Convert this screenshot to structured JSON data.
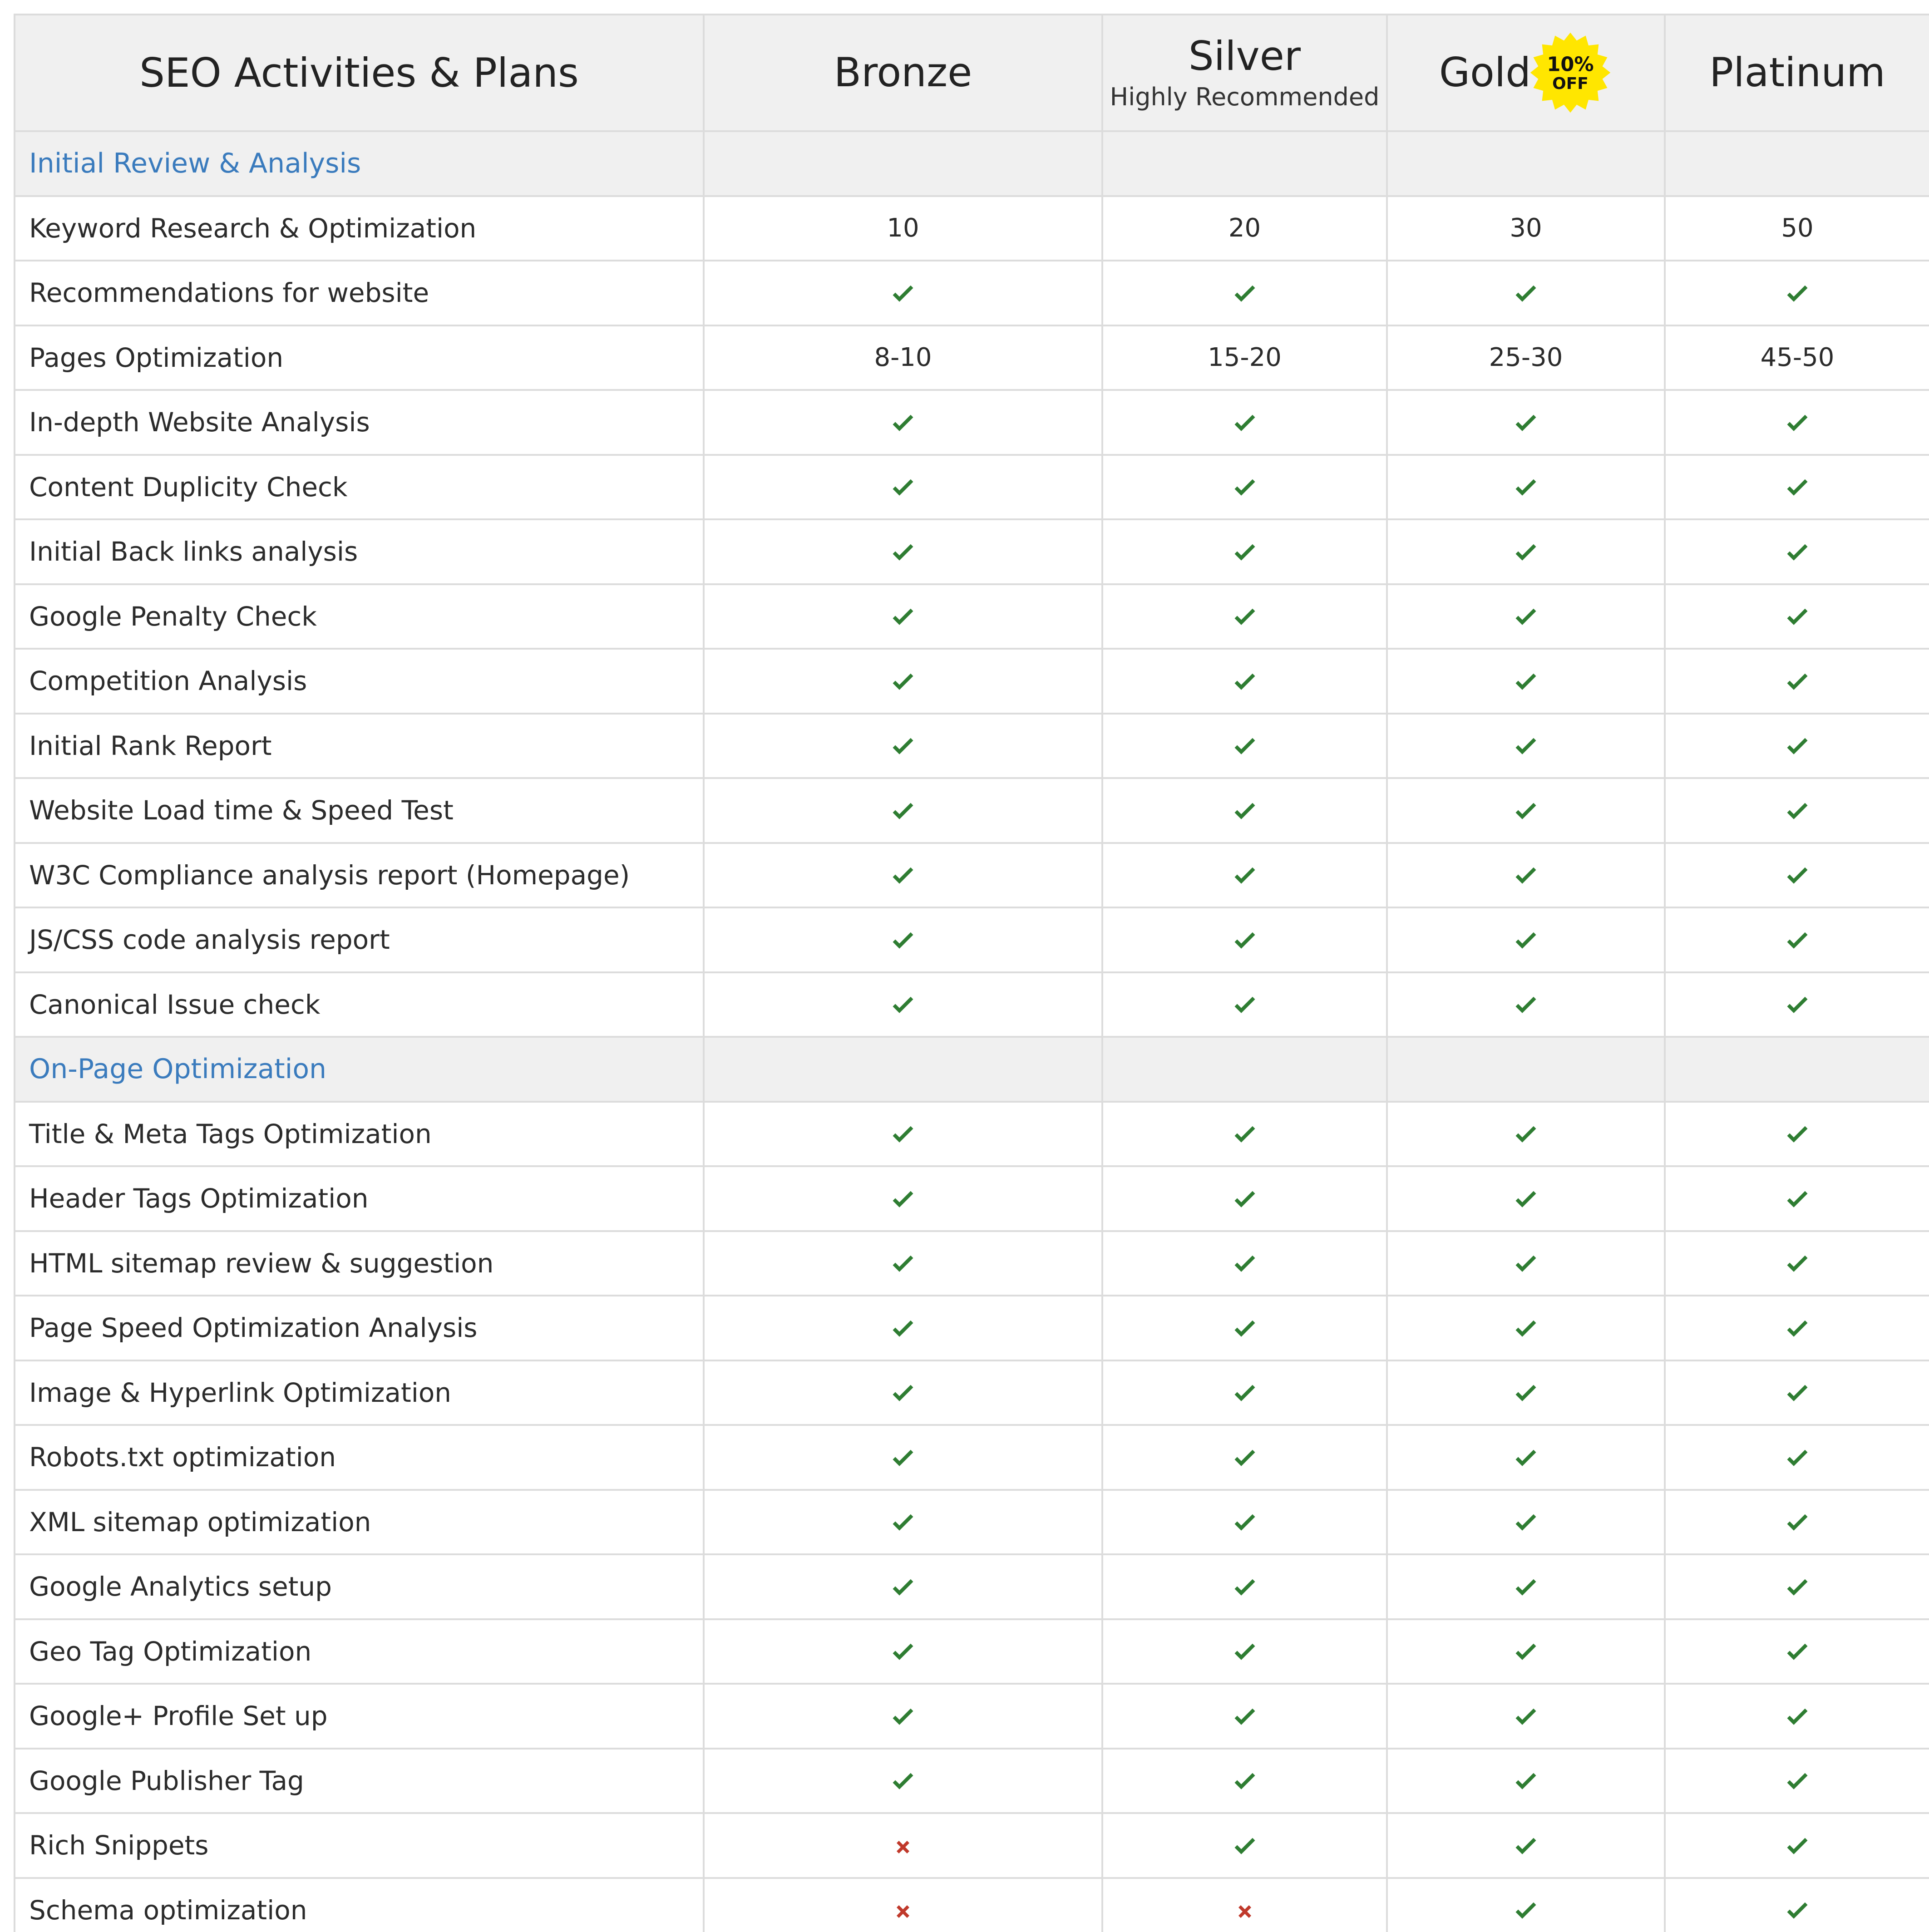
{
  "header": {
    "feature_title": "SEO Activities & Plans",
    "plans": [
      {
        "name": "Bronze",
        "subtitle": ""
      },
      {
        "name": "Silver",
        "subtitle": "Highly Recommended"
      },
      {
        "name": "Gold",
        "subtitle": "",
        "badge_line1": "10%",
        "badge_line2": "OFF"
      },
      {
        "name": "Platinum",
        "subtitle": ""
      }
    ]
  },
  "colors": {
    "section_label": "#3a7bbd",
    "check": "#2e7d32",
    "cross": "#c0392b",
    "header_bg": "#f0f0f0",
    "border": "#dcdcdc",
    "badge": "#ffe600"
  },
  "rows": [
    {
      "type": "section",
      "label": "Initial Review & Analysis"
    },
    {
      "type": "feature",
      "label": "Keyword Research & Optimization",
      "values": [
        "10",
        "20",
        "30",
        "50"
      ]
    },
    {
      "type": "feature",
      "label": "Recommendations for website",
      "values": [
        "check",
        "check",
        "check",
        "check"
      ]
    },
    {
      "type": "feature",
      "label": "Pages Optimization",
      "values": [
        "8-10",
        "15-20",
        "25-30",
        "45-50"
      ]
    },
    {
      "type": "feature",
      "label": "In-depth Website Analysis",
      "values": [
        "check",
        "check",
        "check",
        "check"
      ]
    },
    {
      "type": "feature",
      "label": "Content Duplicity Check",
      "values": [
        "check",
        "check",
        "check",
        "check"
      ]
    },
    {
      "type": "feature",
      "label": "Initial Back links analysis",
      "values": [
        "check",
        "check",
        "check",
        "check"
      ]
    },
    {
      "type": "feature",
      "label": "Google Penalty Check",
      "values": [
        "check",
        "check",
        "check",
        "check"
      ]
    },
    {
      "type": "feature",
      "label": "Competition Analysis",
      "values": [
        "check",
        "check",
        "check",
        "check"
      ]
    },
    {
      "type": "feature",
      "label": "Initial Rank Report",
      "values": [
        "check",
        "check",
        "check",
        "check"
      ]
    },
    {
      "type": "feature",
      "label": "Website Load time & Speed Test",
      "values": [
        "check",
        "check",
        "check",
        "check"
      ]
    },
    {
      "type": "feature",
      "label": "W3C Compliance analysis report (Homepage)",
      "values": [
        "check",
        "check",
        "check",
        "check"
      ]
    },
    {
      "type": "feature",
      "label": "JS/CSS code analysis report",
      "values": [
        "check",
        "check",
        "check",
        "check"
      ]
    },
    {
      "type": "feature",
      "label": "Canonical Issue check",
      "values": [
        "check",
        "check",
        "check",
        "check"
      ]
    },
    {
      "type": "section",
      "label": "On-Page Optimization"
    },
    {
      "type": "feature",
      "label": "Title & Meta Tags Optimization",
      "values": [
        "check",
        "check",
        "check",
        "check"
      ]
    },
    {
      "type": "feature",
      "label": "Header Tags Optimization",
      "values": [
        "check",
        "check",
        "check",
        "check"
      ]
    },
    {
      "type": "feature",
      "label": "HTML sitemap review & suggestion",
      "values": [
        "check",
        "check",
        "check",
        "check"
      ]
    },
    {
      "type": "feature",
      "label": "Page Speed Optimization Analysis",
      "values": [
        "check",
        "check",
        "check",
        "check"
      ]
    },
    {
      "type": "feature",
      "label": "Image & Hyperlink Optimization",
      "values": [
        "check",
        "check",
        "check",
        "check"
      ]
    },
    {
      "type": "feature",
      "label": "Robots.txt optimization",
      "values": [
        "check",
        "check",
        "check",
        "check"
      ]
    },
    {
      "type": "feature",
      "label": "XML sitemap optimization",
      "values": [
        "check",
        "check",
        "check",
        "check"
      ]
    },
    {
      "type": "feature",
      "label": "Google Analytics setup",
      "values": [
        "check",
        "check",
        "check",
        "check"
      ]
    },
    {
      "type": "feature",
      "label": "Geo Tag Optimization",
      "values": [
        "check",
        "check",
        "check",
        "check"
      ]
    },
    {
      "type": "feature",
      "label": "Google+ Profile Set up",
      "values": [
        "check",
        "check",
        "check",
        "check"
      ]
    },
    {
      "type": "feature",
      "label": "Google Publisher Tag",
      "values": [
        "check",
        "check",
        "check",
        "check"
      ]
    },
    {
      "type": "feature",
      "label": "Rich Snippets",
      "values": [
        "cross",
        "check",
        "check",
        "check"
      ]
    },
    {
      "type": "feature",
      "label": "Schema optimization",
      "values": [
        "cross",
        "cross",
        "check",
        "check"
      ]
    }
  ]
}
